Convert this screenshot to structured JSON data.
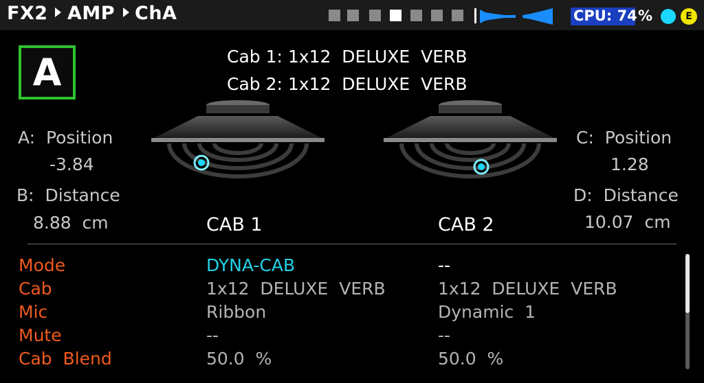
{
  "header": {
    "breadcrumb": [
      "FX2",
      "AMP",
      "ChA"
    ],
    "scene_slots": 8,
    "active_scene_index": 4,
    "cpu_label": "CPU: 74",
    "cpu_percent_sign": "%",
    "status_icons": [
      "cyan-status-dot",
      "edit-indicator"
    ],
    "edit_indicator_label": "E",
    "colors": {
      "cpu_bg": "#1a3fbf",
      "active_dot": "#1bd8ff",
      "edit_badge": "#f2e600",
      "meter": "#1a8dff"
    }
  },
  "channel": {
    "label": "A",
    "border_color": "#2fc22f"
  },
  "cab_titles": {
    "cab1": "Cab 1: 1x12  DELUXE  VERB",
    "cab2": "Cab 2: 1x12  DELUXE  VERB"
  },
  "params": {
    "a_label": "A:  Position",
    "a_value": "-3.84",
    "b_label": "B:  Distance",
    "b_value": "8.88  cm",
    "c_label": "C:  Position",
    "c_value": "1.28",
    "d_label": "D:  Distance",
    "d_value": "10.07  cm"
  },
  "cab_heads": {
    "cab1": "CAB  1",
    "cab2": "CAB  2"
  },
  "table": {
    "rows": [
      {
        "label": "Mode",
        "cab1": "DYNA-CAB",
        "cab2": "--"
      },
      {
        "label": "Cab",
        "cab1": "1x12  DELUXE  VERB",
        "cab2": "1x12  DELUXE  VERB"
      },
      {
        "label": "Mic",
        "cab1": "Ribbon",
        "cab2": "Dynamic  1"
      },
      {
        "label": "Mute",
        "cab1": "--",
        "cab2": "--"
      },
      {
        "label": "Cab  Blend",
        "cab1": "50.0  %",
        "cab2": "50.0  %"
      }
    ],
    "label_color": "#f05a1e",
    "highlight_color": "#21d3e8"
  },
  "scroll": {
    "position_fraction": 0.0,
    "visible_fraction": 0.51
  }
}
